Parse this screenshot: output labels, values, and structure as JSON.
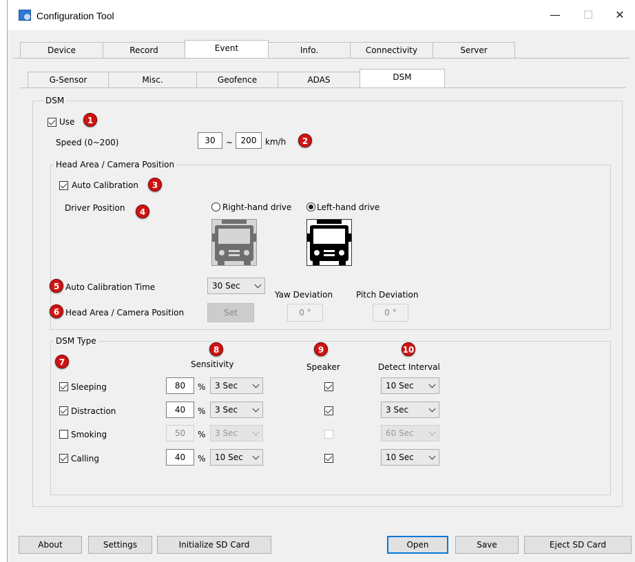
{
  "window": {
    "title": "Configuration Tool",
    "controls": {
      "minimize": "—",
      "maximize": "☐",
      "close": "✕"
    }
  },
  "main_tabs": [
    "Device",
    "Record",
    "Event",
    "Info.",
    "Connectivity",
    "Server"
  ],
  "event_tabs": [
    "G-Sensor",
    "Misc.",
    "Geofence",
    "ADAS",
    "DSM"
  ],
  "dsm": {
    "group_label": "DSM",
    "use_label": "Use",
    "use_checked": true,
    "speed_label": "Speed (0~200)",
    "speed_min": "30",
    "speed_sep": "~",
    "speed_max": "200",
    "speed_unit": "km/h"
  },
  "head_area": {
    "group_label": "Head Area / Camera Position",
    "auto_calibration_label": "Auto Calibration",
    "auto_calibration_checked": true,
    "driver_position_label": "Driver Position",
    "right_hand_label": "Right-hand drive",
    "left_hand_label": "Left-hand drive",
    "selected": "Left-hand drive",
    "auto_calibration_time_label": "Auto Calibration Time",
    "auto_calibration_time_value": "30 Sec",
    "yaw_label": "Yaw Deviation",
    "pitch_label": "Pitch Deviation",
    "head_area_label": "Head Area / Camera Position",
    "set_label": "Set",
    "yaw_value": "0 °",
    "pitch_value": "0 °"
  },
  "dsm_type": {
    "group_label": "DSM Type",
    "col_sensitivity": "Sensitivity",
    "col_speaker": "Speaker",
    "col_interval": "Detect Interval",
    "percent": "%",
    "rows": [
      {
        "label": "Sleeping",
        "checked": true,
        "sensitivity": "80",
        "duration": "3 Sec",
        "speaker": true,
        "interval": "10 Sec",
        "enabled": true
      },
      {
        "label": "Distraction",
        "checked": true,
        "sensitivity": "40",
        "duration": "3 Sec",
        "speaker": true,
        "interval": "3 Sec",
        "enabled": true
      },
      {
        "label": "Smoking",
        "checked": false,
        "sensitivity": "50",
        "duration": "3 Sec",
        "speaker": false,
        "interval": "60 Sec",
        "enabled": false
      },
      {
        "label": "Calling",
        "checked": true,
        "sensitivity": "40",
        "duration": "10 Sec",
        "speaker": true,
        "interval": "10 Sec",
        "enabled": true
      }
    ]
  },
  "badges": [
    "1",
    "2",
    "3",
    "4",
    "5",
    "6",
    "7",
    "8",
    "9",
    "10"
  ],
  "footer": {
    "about": "About",
    "settings": "Settings",
    "initialize": "Initialize SD Card",
    "open": "Open",
    "save": "Save",
    "eject": "Eject SD Card"
  },
  "colors": {
    "badge": "#d11313",
    "primary_border": "#0078d7"
  }
}
